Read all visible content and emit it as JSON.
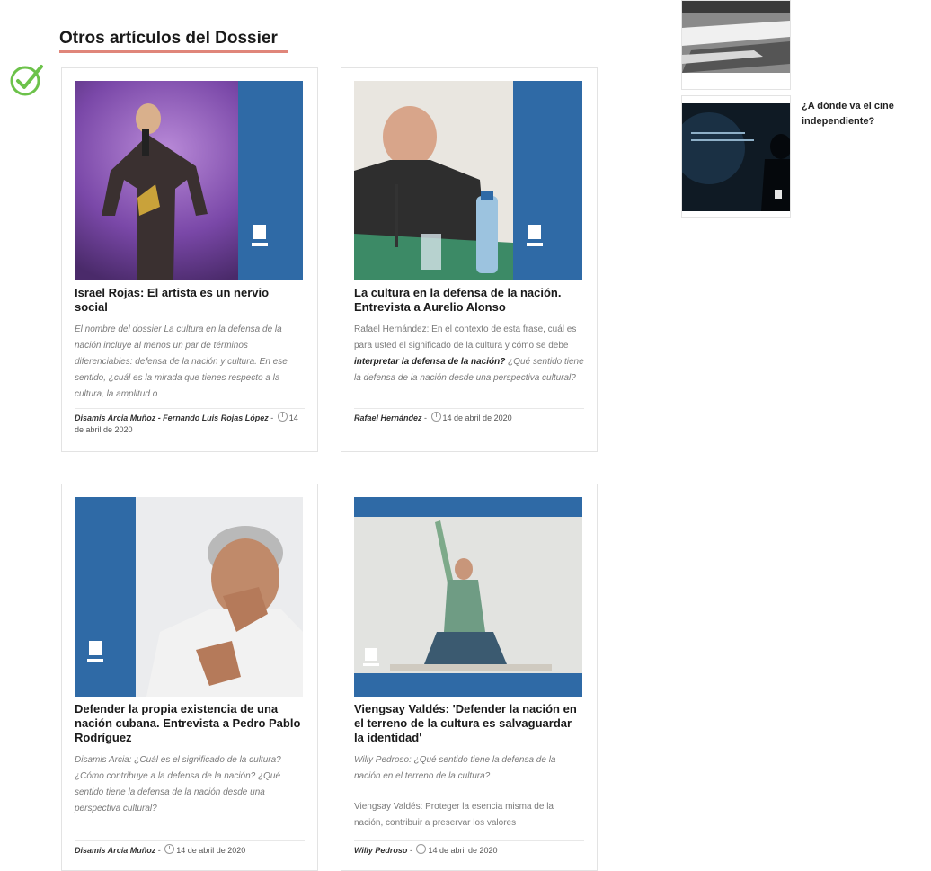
{
  "section": {
    "title": "Otros artículos del Dossier"
  },
  "icons": {
    "check": "check-circle-icon",
    "clock": "clock-icon"
  },
  "colors": {
    "accent_underline": "#e0867a",
    "brand_blue": "#2f6aa6",
    "check_green": "#6cc24a"
  },
  "articles": [
    {
      "title": "Israel Rojas: El artista es un nervio social",
      "excerpt": "El nombre del dossier La cultura en la defensa de la nación incluye al menos un par de términos diferenciables: defensa de la nación y cultura. En ese sentido, ¿cuál es la mirada que tienes respecto a la cultura, la amplitud o",
      "author": "Disamis Arcia Muñoz - Fernando Luis Rojas López",
      "date": "14 de abril de 2020"
    },
    {
      "title": "La cultura en la defensa de la nación. Entrevista a Aurelio Alonso",
      "excerpt_pre": "Rafael Hernández: En el contexto de esta frase, cuál es para usted el significado de la cultura y cómo se debe ",
      "excerpt_bold": "interpretar la defensa de la nación?",
      "excerpt_post": " ¿Qué sentido tiene la defensa de la nación desde una perspectiva cultural?",
      "author": "Rafael Hernández",
      "date": "14 de abril de 2020"
    },
    {
      "title": "Defender la propia existencia de una nación cubana. Entrevista a Pedro Pablo Rodríguez",
      "excerpt": "Disamis Arcia: ¿Cuál es el significado de la cultura? ¿Cómo contribuye a la defensa de la nación? ¿Qué sentido tiene la defensa de la nación desde una perspectiva cultural?",
      "author": "Disamis Arcia Muñoz",
      "date": "14 de abril de 2020"
    },
    {
      "title": "Viengsay Valdés: 'Defender la nación en el terreno de la cultura es salvaguardar la identidad'",
      "excerpt": "Willy Pedroso: ¿Qué sentido tiene la defensa de la nación en el terreno de la cultura?",
      "excerpt2": "Viengsay Valdés: Proteger la esencia misma de la nación, contribuir a preservar los valores",
      "author": "Willy Pedroso",
      "date": "14 de abril de 2020"
    }
  ],
  "sidebar": {
    "items": [
      {
        "title": ""
      },
      {
        "title": "¿A dónde va el cine independiente?"
      }
    ]
  }
}
